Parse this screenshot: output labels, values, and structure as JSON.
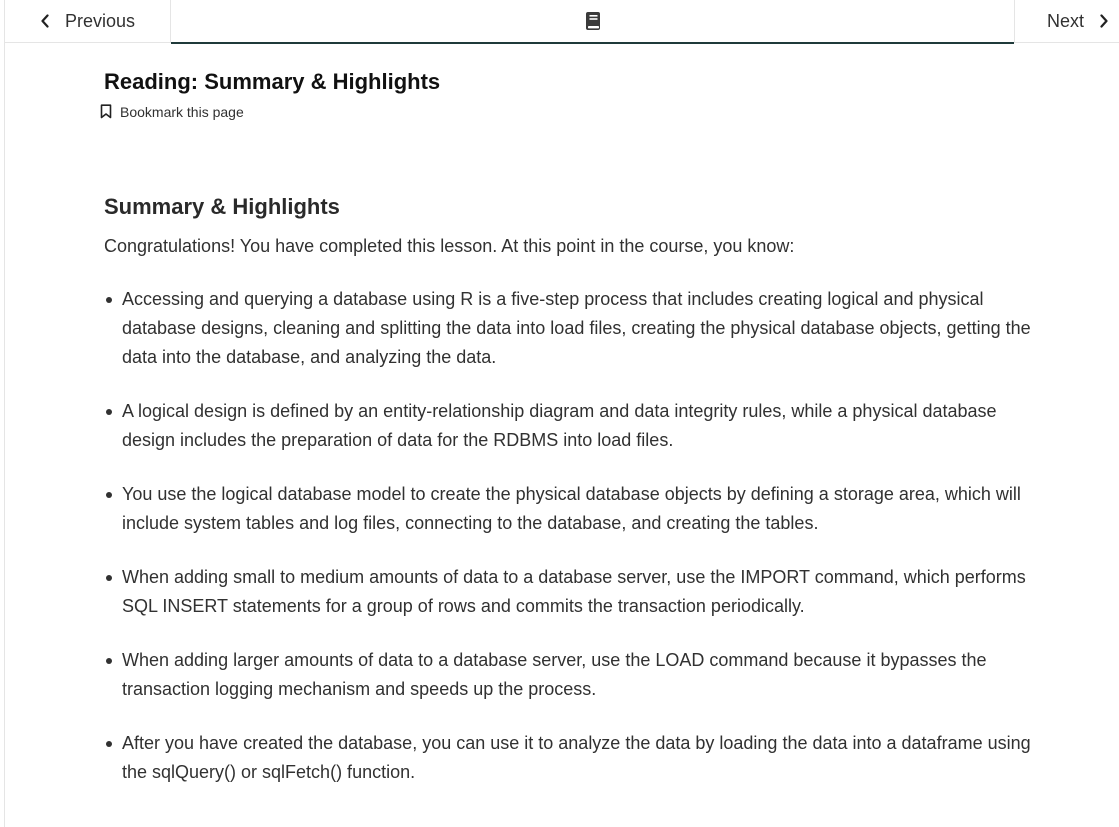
{
  "nav": {
    "previous_label": "Previous",
    "next_label": "Next"
  },
  "page": {
    "title": "Reading: Summary & Highlights",
    "bookmark_label": "Bookmark this page"
  },
  "section": {
    "title": "Summary & Highlights",
    "intro": "Congratulations! You have completed this lesson. At this point in the course, you know:",
    "items": [
      "Accessing and querying a database using R is a five-step process that includes creating logical and physical database designs, cleaning and splitting the data into load files, creating the physical database objects, getting the data into the database, and analyzing the data.",
      "A logical design is defined by an entity-relationship diagram and data integrity rules, while a physical database design includes the preparation of data for the RDBMS into load files.",
      "You use the logical database model to create the physical database objects by defining a storage area, which will include system tables and log files, connecting to the database, and creating the tables.",
      "When adding small to medium amounts of data to a database server, use the IMPORT command, which performs SQL INSERT statements for a group of rows and commits the transaction periodically.",
      "When adding larger amounts of data to a database server, use the LOAD command because it bypasses the transaction logging mechanism and speeds up the process.",
      "After you have created the database, you can use it to analyze the data by loading the data into a dataframe using the sqlQuery() or sqlFetch() function."
    ]
  },
  "icons": {
    "prev": "chevron-left-icon",
    "next": "chevron-right-icon",
    "unit": "book-icon",
    "bookmark": "bookmark-icon"
  }
}
